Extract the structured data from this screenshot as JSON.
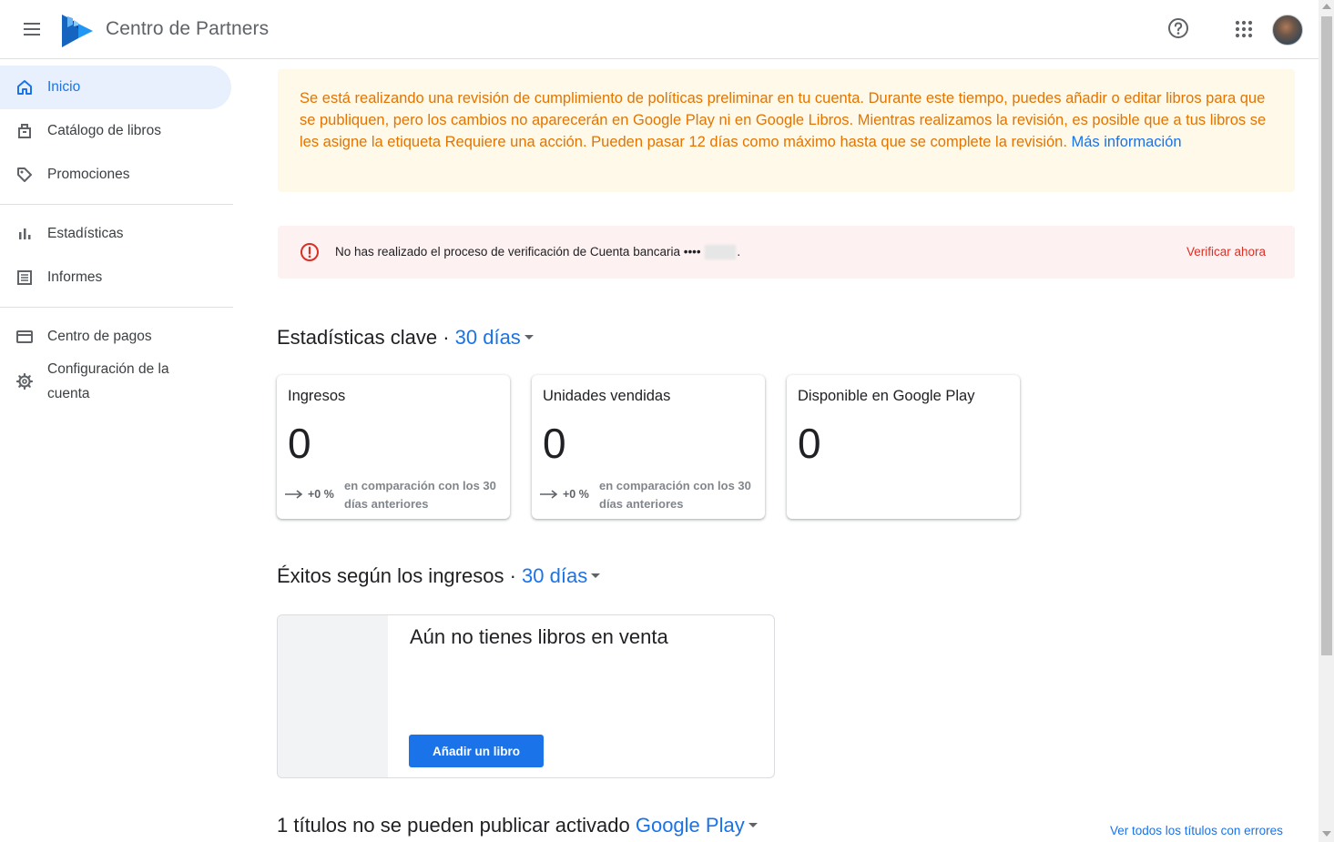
{
  "header": {
    "app_title": "Centro de Partners",
    "icons": [
      "menu-icon",
      "google-play-logo",
      "help-icon",
      "apps-grid-icon",
      "avatar"
    ]
  },
  "sidebar": {
    "items": [
      {
        "label": "Inicio",
        "icon": "home-icon",
        "active": true
      },
      {
        "label": "Catálogo de libros",
        "icon": "book-catalog-icon"
      },
      {
        "label": "Promociones",
        "icon": "tag-icon"
      },
      {
        "label": "Estadísticas",
        "icon": "bar-chart-icon"
      },
      {
        "label": "Informes",
        "icon": "report-icon"
      },
      {
        "label": "Centro de pagos",
        "icon": "credit-card-icon"
      },
      {
        "label": "Configuración de la cuenta",
        "icon": "gear-icon"
      }
    ]
  },
  "notices": {
    "policy_review": {
      "text": "Se está realizando una revisión de cumplimiento de políticas preliminar en tu cuenta. Durante este tiempo, puedes añadir o editar libros para que se publiquen, pero los cambios no aparecerán en Google Play ni en Google Libros. Mientras realizamos la revisión, es posible que a tus libros se les asigne la etiqueta Requiere una acción. Pueden pasar 12 días como máximo hasta que se complete la revisión.",
      "link": "Más información"
    },
    "bank_verification": {
      "text": "No has realizado el proceso de verificación de Cuenta bancaria ••••",
      "suffix": ".",
      "action": "Verificar ahora"
    }
  },
  "key_stats": {
    "title": "Estadísticas clave ·",
    "period": "30 días",
    "cards": [
      {
        "title": "Ingresos",
        "value": "0",
        "change": "+0 %",
        "comparison": "en comparación con los 30 días anteriores"
      },
      {
        "title": "Unidades vendidas",
        "value": "0",
        "change": "+0 %",
        "comparison": "en comparación con los 30 días anteriores"
      },
      {
        "title": "Disponible en Google Play",
        "value": "0"
      }
    ]
  },
  "top_sellers": {
    "title": "Éxitos según los ingresos ·",
    "period": "30 días",
    "empty_title": "Aún no tienes libros en venta",
    "add_button": "Añadir un libro"
  },
  "unpublishable": {
    "title": "1 títulos no se pueden publicar activado",
    "store": "Google Play",
    "view_all": "Ver todos los títulos con errores"
  },
  "colors": {
    "accent": "#1a73e8",
    "warning_text": "#e37400",
    "warning_bg": "#fef9e9",
    "error": "#d93025",
    "error_bg": "#fdf1f1"
  }
}
